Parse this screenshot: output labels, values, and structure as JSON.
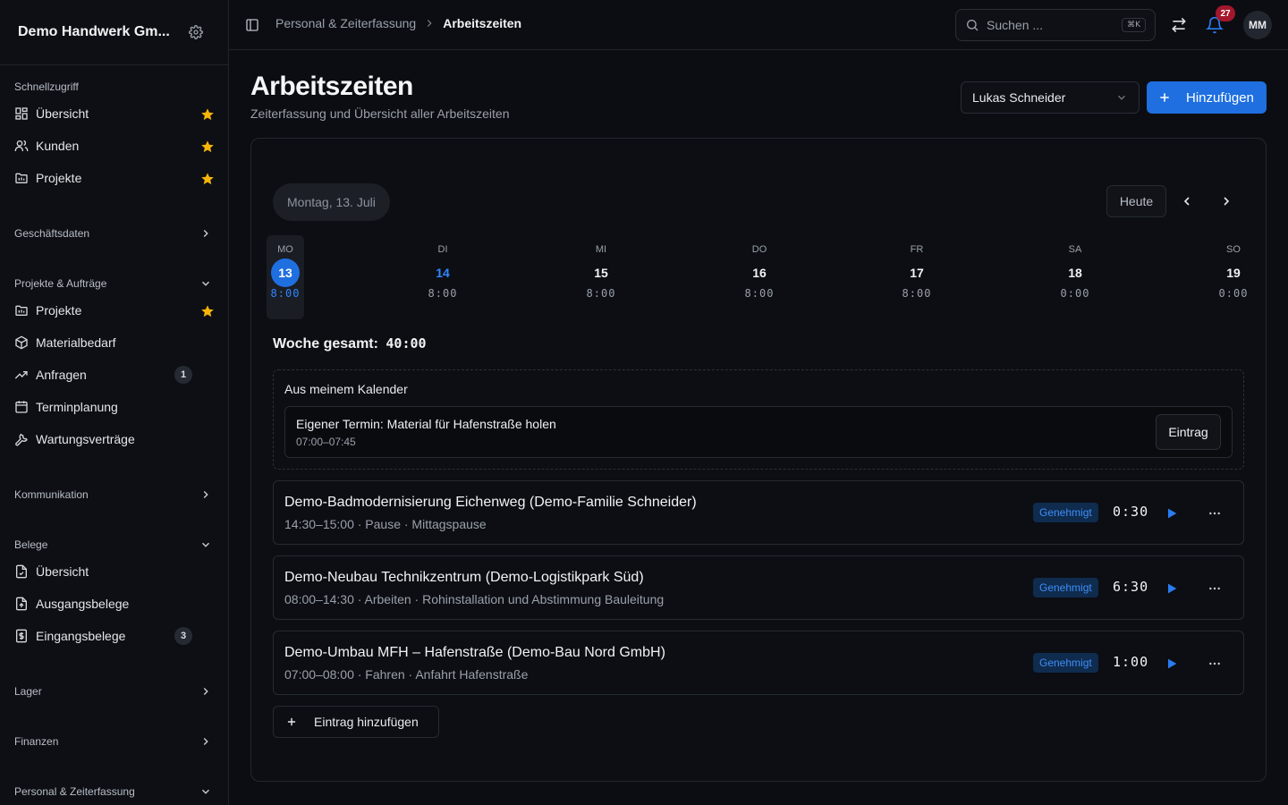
{
  "sidebar": {
    "company": "Demo Handwerk Gm...",
    "sections": {
      "quick": {
        "title": "Schnellzugriff",
        "items": [
          "Übersicht",
          "Kunden",
          "Projekte"
        ]
      },
      "business": {
        "title": "Geschäftsdaten"
      },
      "projects": {
        "title": "Projekte & Aufträge",
        "items": [
          "Projekte",
          "Materialbedarf",
          "Anfragen",
          "Terminplanung",
          "Wartungsverträge"
        ],
        "anfragen_count": "1"
      },
      "communication": {
        "title": "Kommunikation"
      },
      "documents": {
        "title": "Belege",
        "items": [
          "Übersicht",
          "Ausgangsbelege",
          "Eingangsbelege"
        ],
        "eingangsbelege_count": "3"
      },
      "warehouse": {
        "title": "Lager"
      },
      "finance": {
        "title": "Finanzen"
      },
      "hr": {
        "title": "Personal & Zeiterfassung"
      }
    }
  },
  "topbar": {
    "breadcrumb_parent": "Personal & Zeiterfassung",
    "breadcrumb_current": "Arbeitszeiten",
    "search_placeholder": "Suchen ...",
    "search_shortcut": "⌘K",
    "notification_count": "27",
    "avatar_initials": "MM"
  },
  "page": {
    "title": "Arbeitszeiten",
    "subtitle": "Zeiterfassung und Übersicht aller Arbeitszeiten",
    "employee": "Lukas Schneider",
    "add_label": "Hinzufügen"
  },
  "calendar": {
    "date_label": "Montag, 13. Juli",
    "today_label": "Heute",
    "days": [
      {
        "name": "MO",
        "num": "13",
        "time": "8:00"
      },
      {
        "name": "DI",
        "num": "14",
        "time": "8:00"
      },
      {
        "name": "MI",
        "num": "15",
        "time": "8:00"
      },
      {
        "name": "DO",
        "num": "16",
        "time": "8:00"
      },
      {
        "name": "FR",
        "num": "17",
        "time": "8:00"
      },
      {
        "name": "SA",
        "num": "18",
        "time": "0:00"
      },
      {
        "name": "SO",
        "num": "19",
        "time": "0:00"
      }
    ],
    "week_total_label": "Woche gesamt:",
    "week_total_value": "40:00"
  },
  "my_calendar": {
    "title": "Aus meinem Kalender",
    "entry_title": "Eigener Termin: Material für Hafenstraße holen",
    "entry_time": "07:00–07:45",
    "entry_button": "Eintrag"
  },
  "entries": [
    {
      "title": "Demo-Badmodernisierung Eichenweg (Demo-Familie Schneider)",
      "sub": "14:30–15:00 · Pause · Mittagspause",
      "status": "Genehmigt",
      "duration": "0:30"
    },
    {
      "title": "Demo-Neubau Technikzentrum (Demo-Logistikpark Süd)",
      "sub": "08:00–14:30 · Arbeiten · Rohinstallation und Abstimmung Bauleitung",
      "status": "Genehmigt",
      "duration": "6:30"
    },
    {
      "title": "Demo-Umbau MFH – Hafenstraße (Demo-Bau Nord GmbH)",
      "sub": "07:00–08:00 · Fahren · Anfahrt Hafenstraße",
      "status": "Genehmigt",
      "duration": "1:00"
    }
  ],
  "add_entry_label": "Eintrag hinzufügen",
  "colors": {
    "accent": "#1f6fe0",
    "star": "#f5b50a",
    "badge_bg": "#0f2b4e",
    "badge_text": "#3f8ef5",
    "notification": "#a3162b"
  }
}
